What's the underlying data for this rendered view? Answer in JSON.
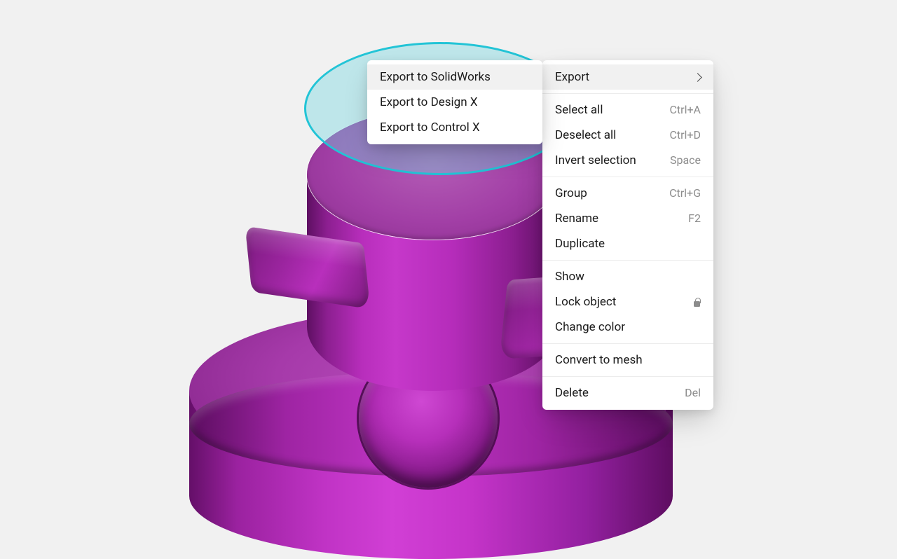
{
  "context_menu": {
    "export": {
      "label": "Export",
      "has_submenu": true
    },
    "select_all": {
      "label": "Select all",
      "hotkey": "Ctrl+A"
    },
    "deselect_all": {
      "label": "Deselect all",
      "hotkey": "Ctrl+D"
    },
    "invert_selection": {
      "label": "Invert selection",
      "hotkey": "Space"
    },
    "group": {
      "label": "Group",
      "hotkey": "Ctrl+G"
    },
    "rename": {
      "label": "Rename",
      "hotkey": "F2"
    },
    "duplicate": {
      "label": "Duplicate"
    },
    "show": {
      "label": "Show"
    },
    "lock_object": {
      "label": "Lock object",
      "icon": "lock"
    },
    "change_color": {
      "label": "Change color"
    },
    "convert_to_mesh": {
      "label": "Convert to mesh"
    },
    "delete": {
      "label": "Delete",
      "hotkey": "Del"
    }
  },
  "export_submenu": {
    "solidworks": {
      "label": "Export to SolidWorks"
    },
    "design_x": {
      "label": "Export to Design X"
    },
    "control_x": {
      "label": "Export to Control X"
    }
  },
  "viewport": {
    "selection_highlight_color": "#22c4d6",
    "object_color": "#b82ebc",
    "selected_face": "top-cap"
  }
}
